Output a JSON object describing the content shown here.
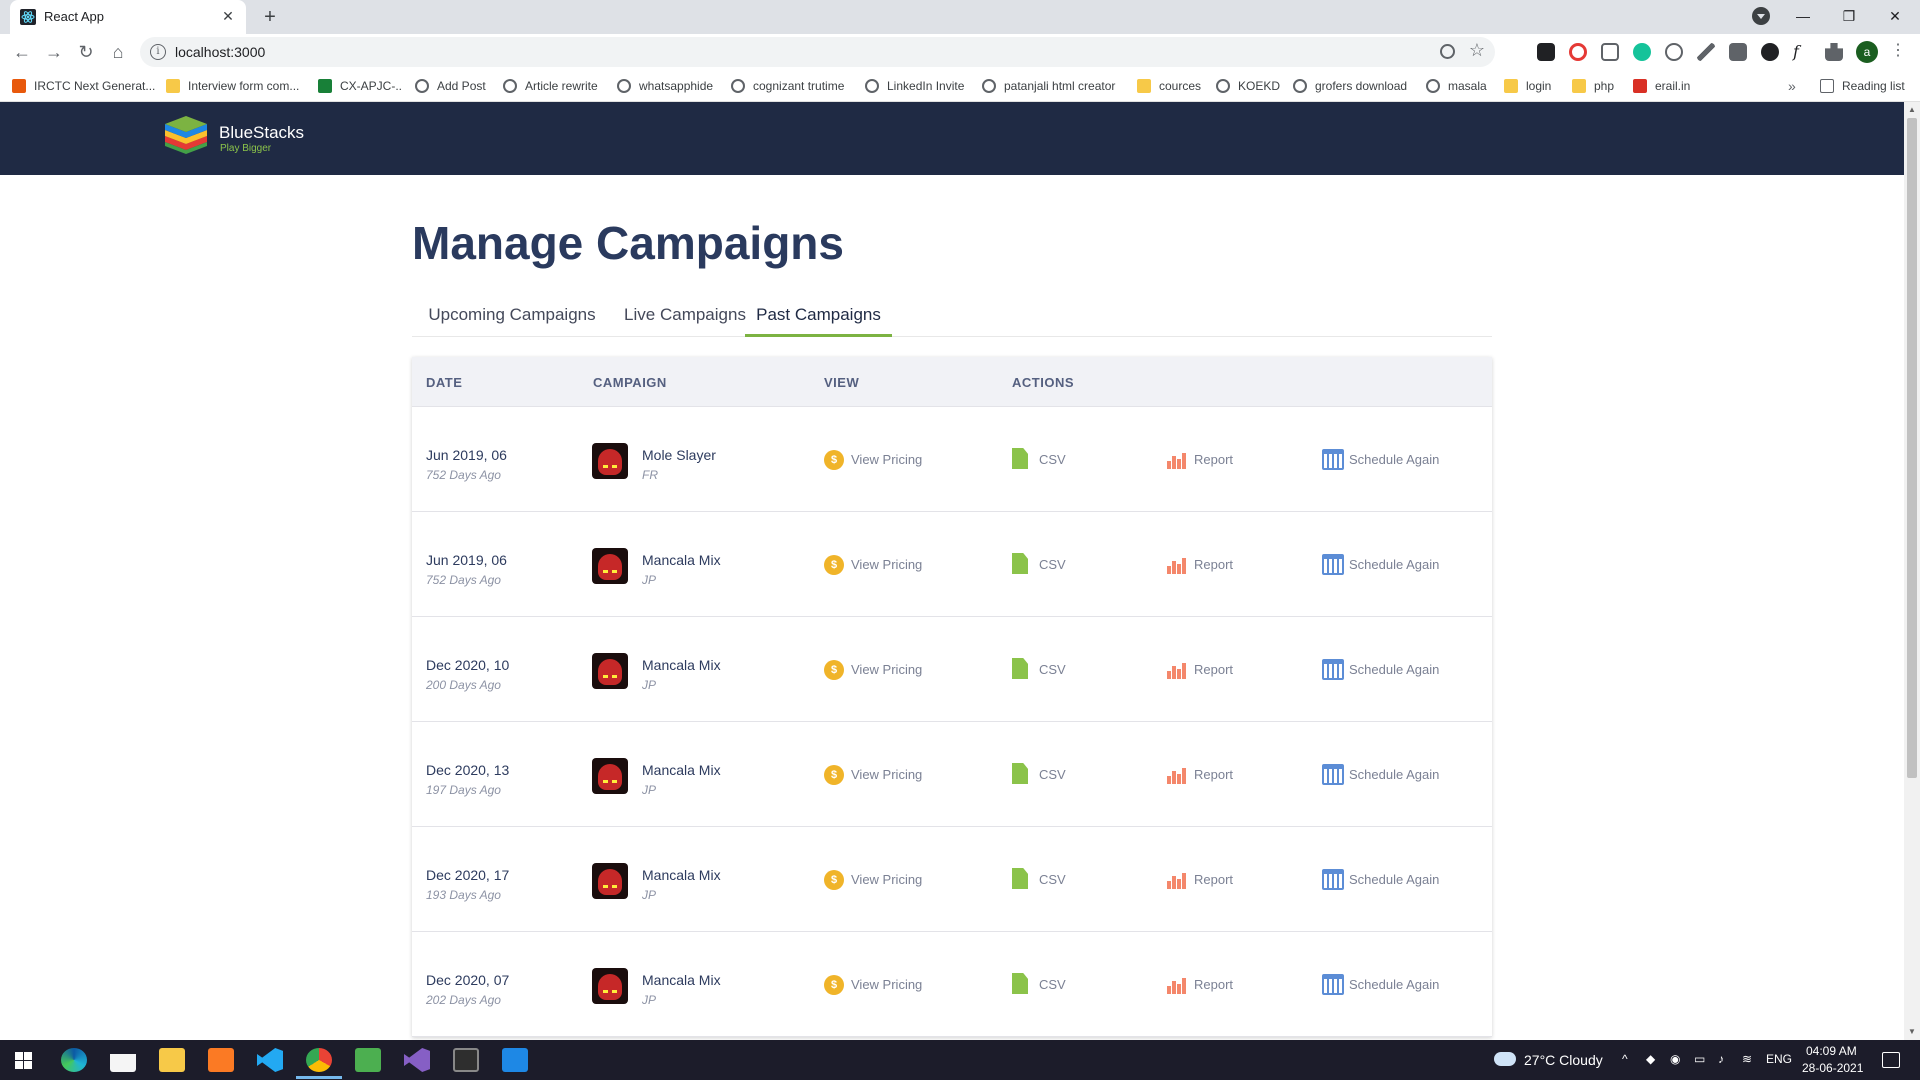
{
  "browser": {
    "tab_title": "React App",
    "url": "localhost:3000",
    "bookmarks": [
      {
        "label": "IRCTC Next Generat...",
        "icon": "orange"
      },
      {
        "label": "Interview form com...",
        "icon": "folder"
      },
      {
        "label": "CX-APJC-..",
        "icon": "green"
      },
      {
        "label": "Add Post",
        "icon": "globe"
      },
      {
        "label": "Article rewrite",
        "icon": "globe"
      },
      {
        "label": "whatsapphide",
        "icon": "globe"
      },
      {
        "label": "cognizant trutime",
        "icon": "globe"
      },
      {
        "label": "LinkedIn Invite",
        "icon": "globe"
      },
      {
        "label": "patanjali html creator",
        "icon": "globe"
      },
      {
        "label": "cources",
        "icon": "folder"
      },
      {
        "label": "KOEKD",
        "icon": "globe"
      },
      {
        "label": "grofers download",
        "icon": "globe"
      },
      {
        "label": "masala",
        "icon": "globe"
      },
      {
        "label": "login",
        "icon": "folder"
      },
      {
        "label": "php",
        "icon": "folder"
      },
      {
        "label": "erail.in",
        "icon": "red"
      }
    ],
    "bookmarks_more": "»",
    "reading_list": "Reading list",
    "profile_initial": "a"
  },
  "app": {
    "brand_name": "BlueStacks",
    "brand_tagline": "Play Bigger",
    "page_title": "Manage Campaigns",
    "tabs": [
      "Upcoming Campaigns",
      "Live Campaigns",
      "Past Campaigns"
    ],
    "active_tab": "Past Campaigns",
    "accent_color": "#7cb342",
    "header_color": "#1f2a44",
    "table": {
      "headers": [
        "DATE",
        "CAMPAIGN",
        "VIEW",
        "ACTIONS"
      ],
      "view_label": "View Pricing",
      "csv_label": "CSV",
      "report_label": "Report",
      "schedule_label": "Schedule Again",
      "rows": [
        {
          "date": "Jun 2019, 06",
          "ago": "752 Days Ago",
          "name": "Mole Slayer",
          "region": "FR"
        },
        {
          "date": "Jun 2019, 06",
          "ago": "752 Days Ago",
          "name": "Mancala Mix",
          "region": "JP"
        },
        {
          "date": "Dec 2020, 10",
          "ago": "200 Days Ago",
          "name": "Mancala Mix",
          "region": "JP"
        },
        {
          "date": "Dec 2020, 13",
          "ago": "197 Days Ago",
          "name": "Mancala Mix",
          "region": "JP"
        },
        {
          "date": "Dec 2020, 17",
          "ago": "193 Days Ago",
          "name": "Mancala Mix",
          "region": "JP"
        },
        {
          "date": "Dec 2020, 07",
          "ago": "202 Days Ago",
          "name": "Mancala Mix",
          "region": "JP"
        }
      ]
    }
  },
  "taskbar": {
    "weather": "27°C  Cloudy",
    "language": "ENG",
    "time": "04:09 AM",
    "date": "28-06-2021"
  }
}
